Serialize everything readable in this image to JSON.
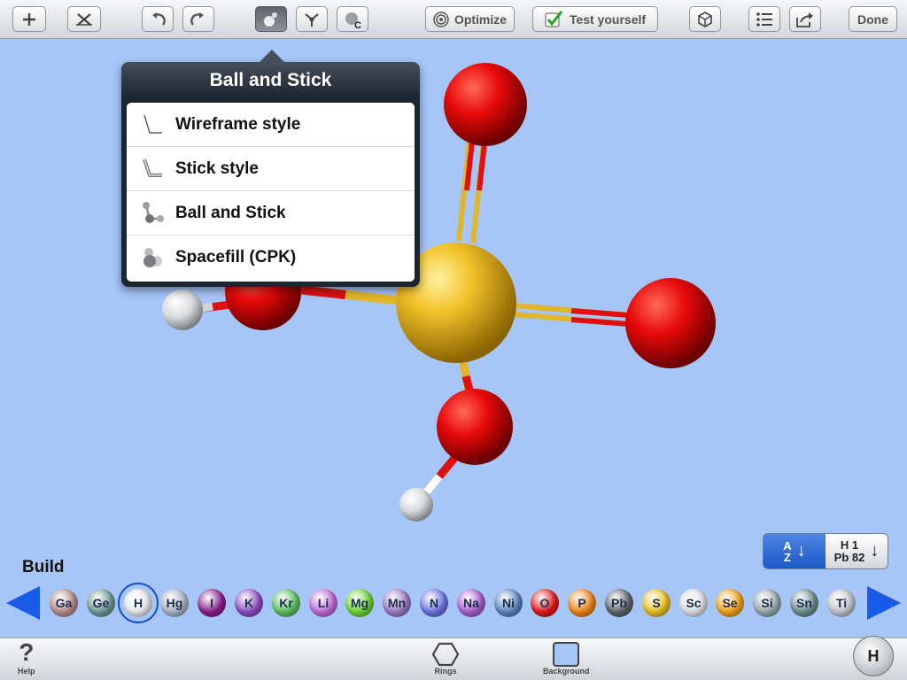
{
  "toolbar": {
    "add_icon": "plus-icon",
    "delete_icon": "x-icon",
    "undo_icon": "undo-icon",
    "redo_icon": "redo-icon",
    "style_icon": "ball-and-stick-icon",
    "measure_icon": "bond-tool-icon",
    "cleanup_icon": "atom-c-icon",
    "optimize_label": "Optimize",
    "test_label": "Test yourself",
    "cube_icon": "3d-cube-icon",
    "list_icon": "list-icon",
    "share_icon": "share-icon",
    "done_label": "Done"
  },
  "popover": {
    "title": "Ball and Stick",
    "items": [
      {
        "label": "Wireframe style",
        "icon": "wireframe-icon"
      },
      {
        "label": "Stick style",
        "icon": "stick-icon"
      },
      {
        "label": "Ball and Stick",
        "icon": "ball-stick-icon"
      },
      {
        "label": "Spacefill (CPK)",
        "icon": "spacefill-icon"
      }
    ]
  },
  "build_label": "Build",
  "sort": {
    "alpha_top": "A",
    "alpha_bottom": "Z",
    "num_top": "H 1",
    "num_bottom": "Pb 82"
  },
  "elements": [
    {
      "symbol": "Ga",
      "color": "#b98a8a"
    },
    {
      "symbol": "Ge",
      "color": "#6e9a96"
    },
    {
      "symbol": "H",
      "color": "#e6e8ea",
      "selected": true
    },
    {
      "symbol": "Hg",
      "color": "#aab4c4"
    },
    {
      "symbol": "I",
      "color": "#8a1f8a"
    },
    {
      "symbol": "K",
      "color": "#8c4cc4"
    },
    {
      "symbol": "Kr",
      "color": "#5cc05c"
    },
    {
      "symbol": "Li",
      "color": "#c06ad6"
    },
    {
      "symbol": "Mg",
      "color": "#6cd630"
    },
    {
      "symbol": "Mn",
      "color": "#9a7ac4"
    },
    {
      "symbol": "N",
      "color": "#6c74e0"
    },
    {
      "symbol": "Na",
      "color": "#a85ed0"
    },
    {
      "symbol": "Ni",
      "color": "#5a86c0"
    },
    {
      "symbol": "O",
      "color": "#e01818"
    },
    {
      "symbol": "P",
      "color": "#ee8418"
    },
    {
      "symbol": "Pb",
      "color": "#5e646c"
    },
    {
      "symbol": "S",
      "color": "#e8c020"
    },
    {
      "symbol": "Sc",
      "color": "#dcdde0"
    },
    {
      "symbol": "Se",
      "color": "#f0a018"
    },
    {
      "symbol": "Si",
      "color": "#96a8a8"
    },
    {
      "symbol": "Sn",
      "color": "#6e8c8e"
    },
    {
      "symbol": "Ti",
      "color": "#c0c4c8"
    }
  ],
  "bottom": {
    "help_label": "Help",
    "rings_label": "Rings",
    "background_label": "Background",
    "current_element": "H"
  }
}
